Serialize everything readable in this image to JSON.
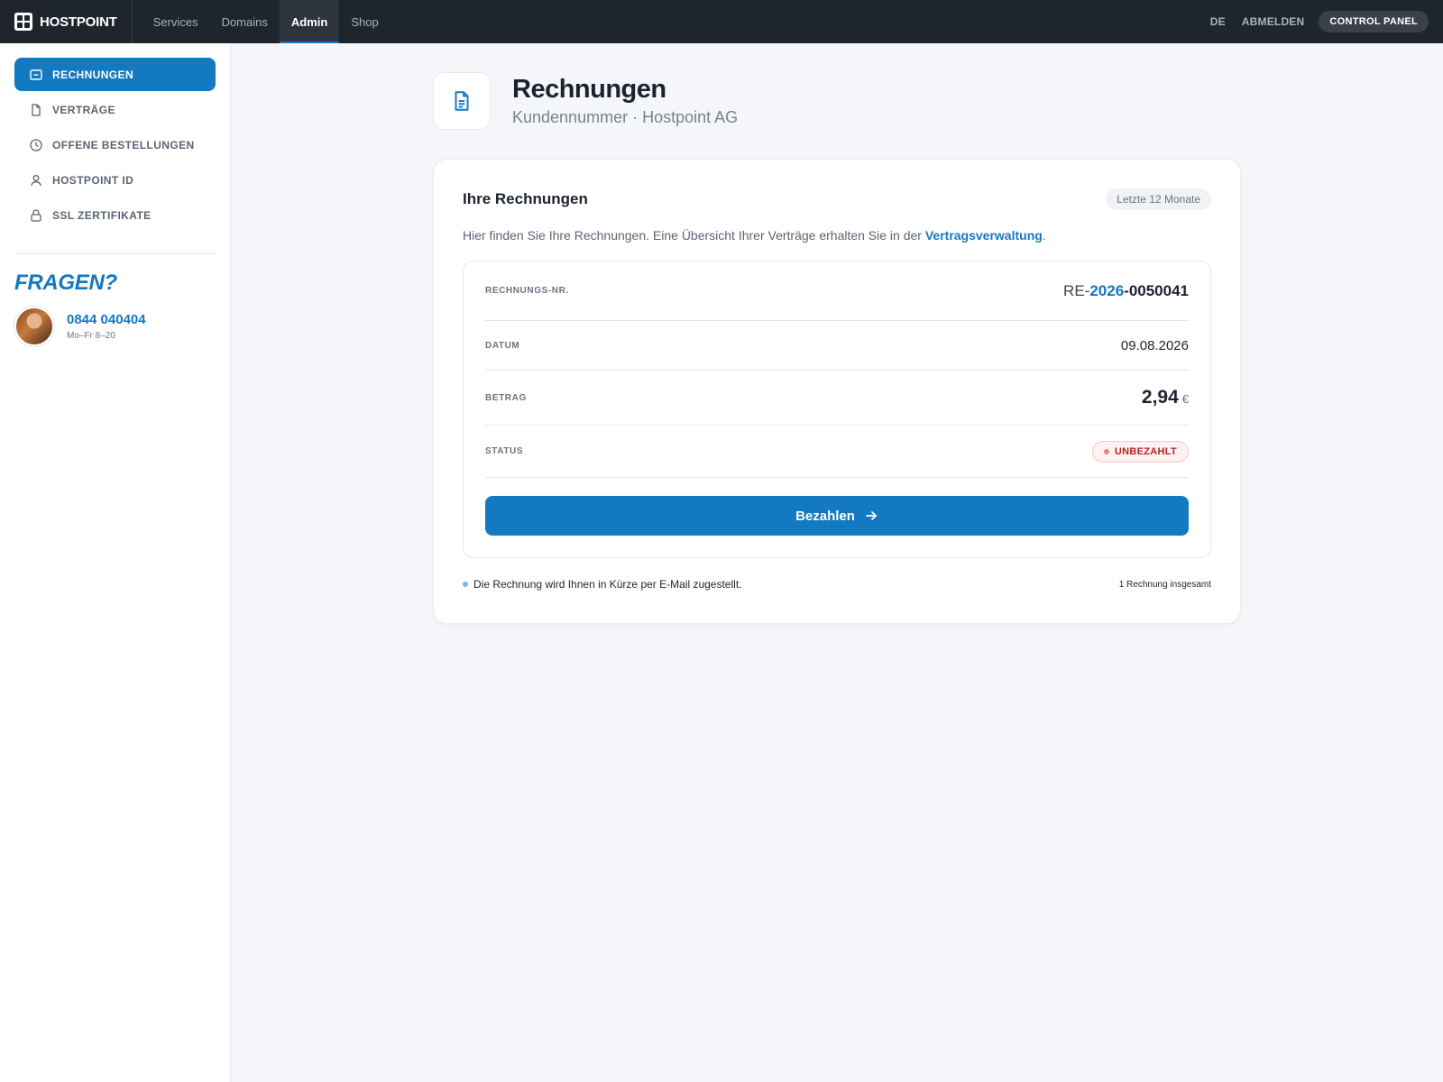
{
  "topbar": {
    "brand": "HOSTPOINT",
    "tabs": [
      {
        "label": "Services",
        "active": false
      },
      {
        "label": "Domains",
        "active": false
      },
      {
        "label": "Admin",
        "active": true
      },
      {
        "label": "Shop",
        "active": false
      }
    ],
    "lang": "DE",
    "logout": "ABMELDEN",
    "control_panel": "CONTROL PANEL"
  },
  "sidebar": {
    "items": [
      {
        "label": "RECHNUNGEN",
        "icon": "invoice-icon",
        "active": true
      },
      {
        "label": "VERTRÄGE",
        "icon": "document-icon",
        "active": false
      },
      {
        "label": "OFFENE BESTELLUNGEN",
        "icon": "clock-icon",
        "active": false
      },
      {
        "label": "HOSTPOINT ID",
        "icon": "user-icon",
        "active": false
      },
      {
        "label": "SSL ZERTIFIKATE",
        "icon": "lock-icon",
        "active": false
      }
    ],
    "faq_title": "FRAGEN?",
    "phone": "0844 040404",
    "hours": "Mo–Fr 8–20"
  },
  "page": {
    "title": "Rechnungen",
    "subtitle": "Kundennummer · Hostpoint AG"
  },
  "card": {
    "title": "Ihre Rechnungen",
    "period": "Letzte 12 Monate",
    "desc_text": "Hier finden Sie Ihre Rechnungen. Eine Übersicht Ihrer Verträge erhalten Sie in der ",
    "desc_link": "Vertragsverwaltung",
    "desc_end": ".",
    "invoice": {
      "no_label": "RECHNUNGS-NR.",
      "no_prefix": "RE-",
      "no_year": "2026",
      "no_suffix": "-0050041",
      "date_label": "DATUM",
      "date": "09.08.2026",
      "amount_label": "BETRAG",
      "amount": "2,94",
      "currency": "€",
      "status_label": "STATUS",
      "status": "UNBEZAHLT"
    },
    "pay_button": "Bezahlen",
    "note": "Die Rechnung wird Ihnen in Kürze per E-Mail zugestellt.",
    "count": "1 Rechnung insgesamt"
  },
  "colors": {
    "accent": "#1379c0",
    "topbar": "#1f252d",
    "status_unpaid": "#b42323"
  }
}
